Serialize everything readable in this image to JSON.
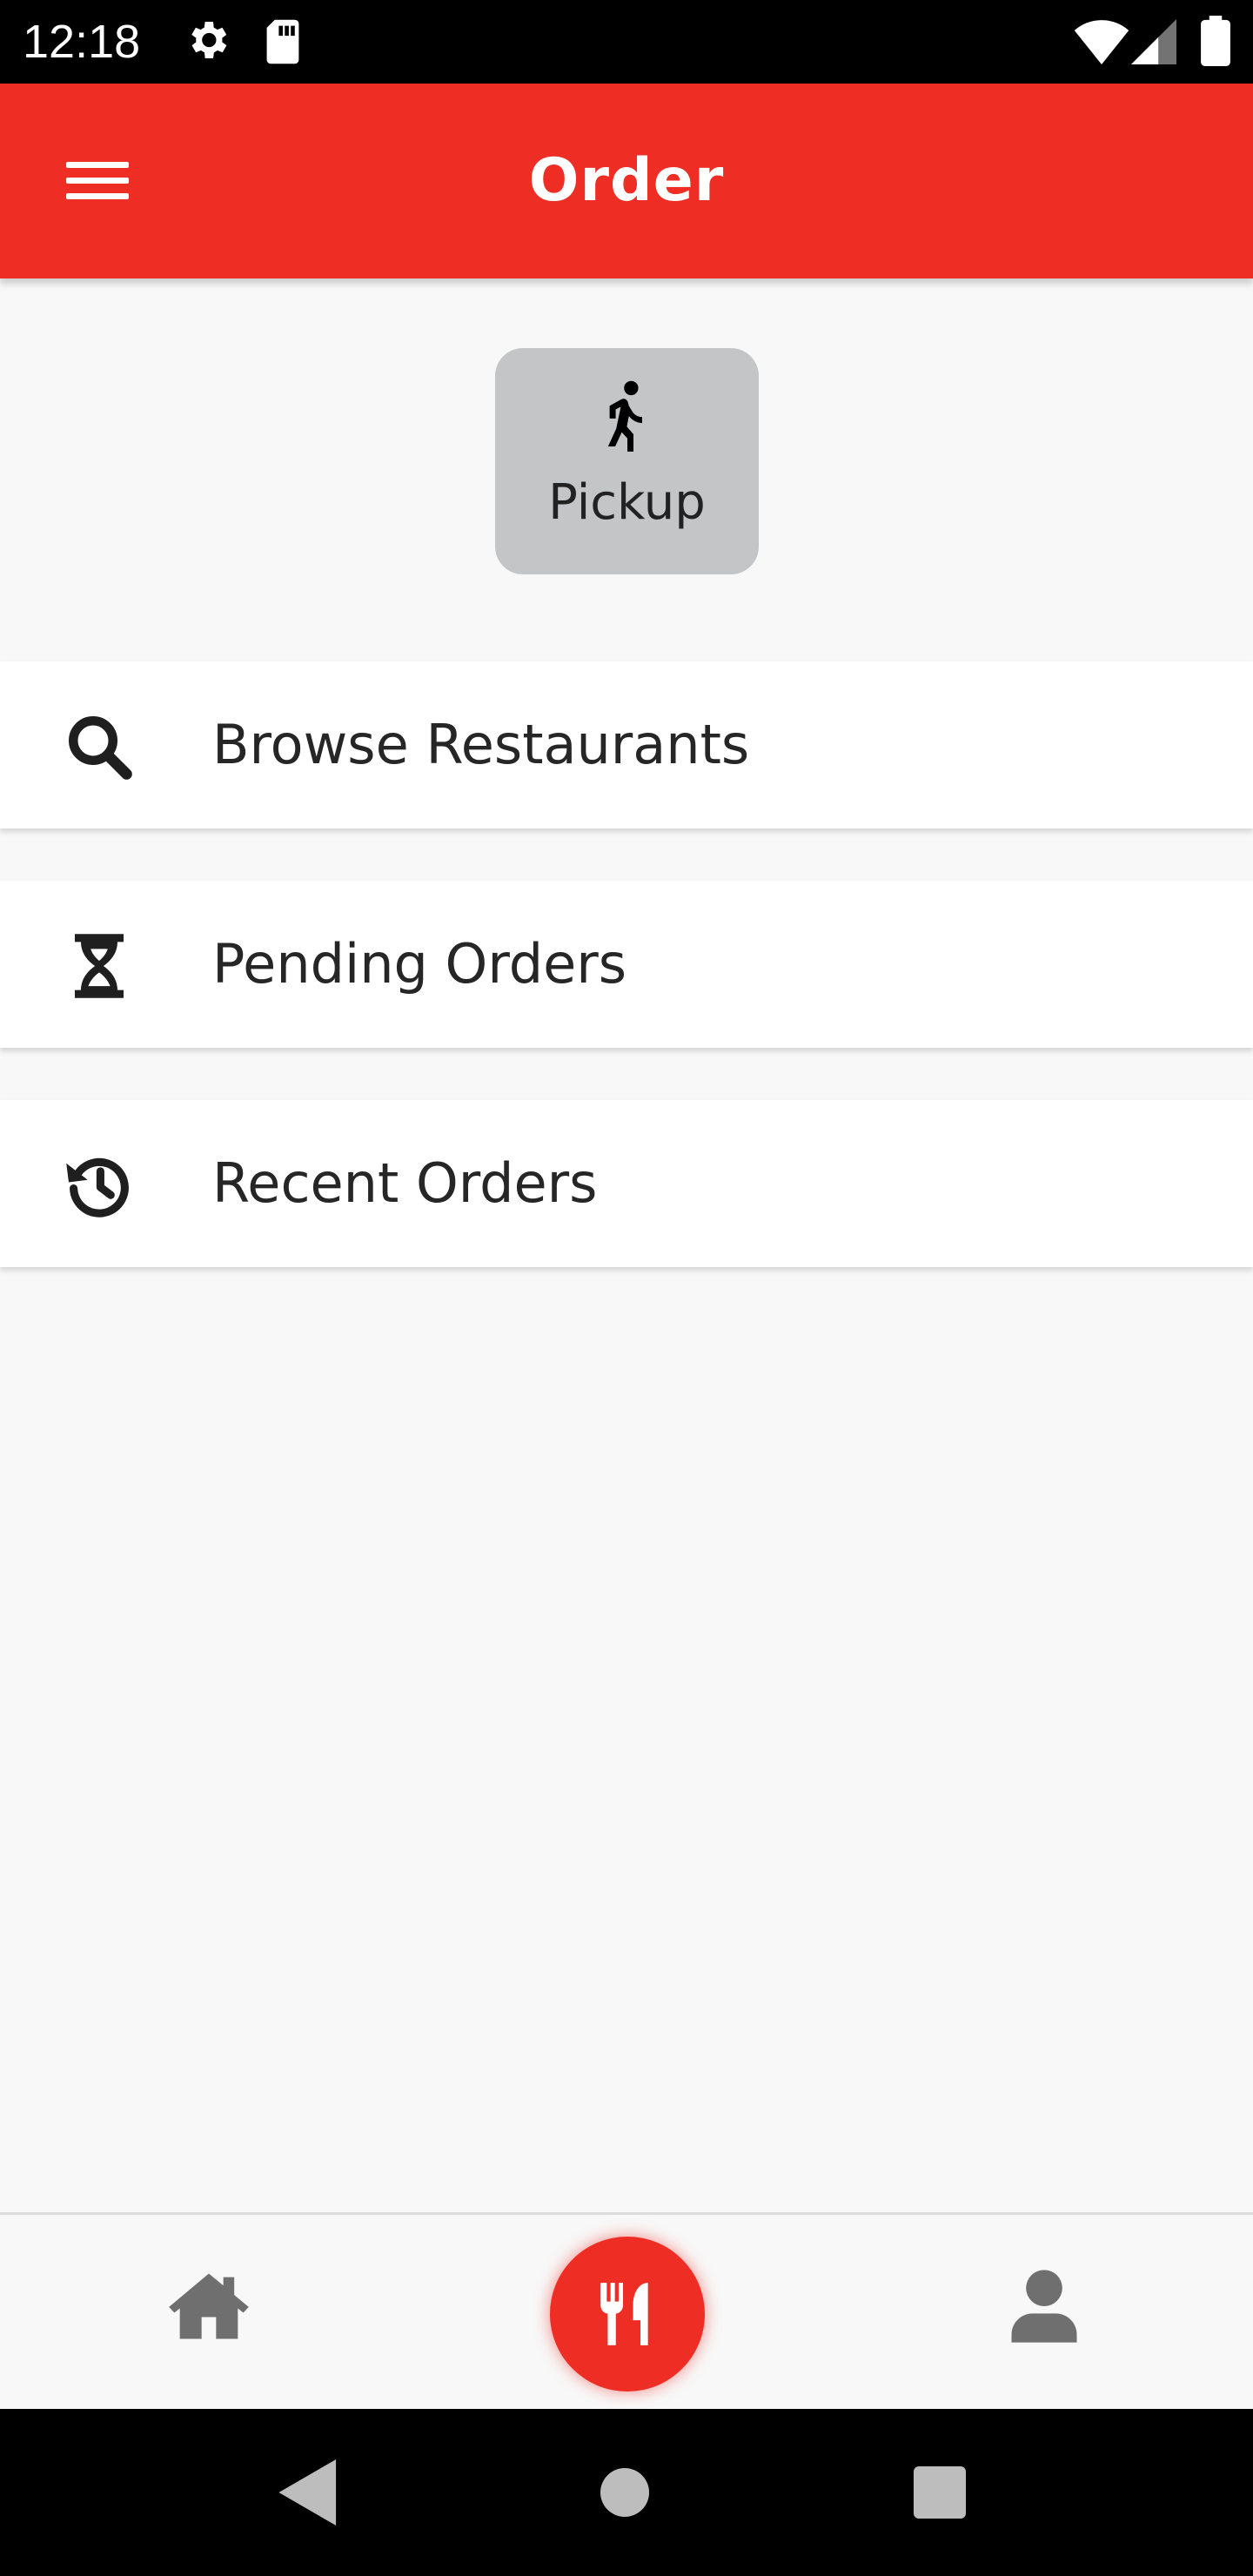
{
  "status_bar": {
    "time": "12:18",
    "icons": [
      "settings-icon",
      "sd-card-icon",
      "wifi-icon",
      "cell-signal-icon",
      "battery-icon"
    ]
  },
  "app_bar": {
    "title": "Order",
    "menu_icon": "hamburger-menu-icon",
    "background": "#ee2d25"
  },
  "pickup": {
    "label": "Pickup",
    "icon": "walking-person-icon",
    "background": "#c4c5c7"
  },
  "menu": [
    {
      "label": "Browse Restaurants",
      "icon": "search-icon"
    },
    {
      "label": "Pending Orders",
      "icon": "hourglass-icon"
    },
    {
      "label": "Recent Orders",
      "icon": "history-icon"
    }
  ],
  "bottom_nav": {
    "items": [
      {
        "id": "home",
        "icon": "home-icon",
        "active": false
      },
      {
        "id": "order",
        "icon": "utensils-icon",
        "active": true
      },
      {
        "id": "profile",
        "icon": "user-icon",
        "active": false
      }
    ],
    "active_color": "#ee2d25",
    "inactive_color": "#6f6f6f"
  },
  "system_nav": {
    "icons": [
      "back-icon",
      "home-circle-icon",
      "recents-icon"
    ]
  }
}
